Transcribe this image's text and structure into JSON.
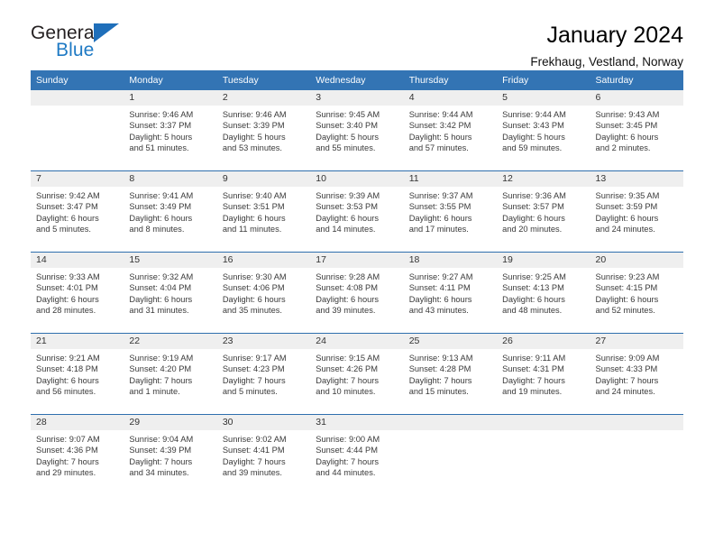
{
  "brand": {
    "name_part1": "General",
    "name_part2": "Blue",
    "accent_color": "#1f7ac4",
    "triangle_color": "#1f6fba"
  },
  "header": {
    "title": "January 2024",
    "subtitle": "Frekhaug, Vestland, Norway"
  },
  "theme": {
    "header_row_bg": "#3374b4",
    "daynum_bg": "#efefef",
    "week_divider": "#2f6fae"
  },
  "calendar": {
    "weekday_headers": [
      "Sunday",
      "Monday",
      "Tuesday",
      "Wednesday",
      "Thursday",
      "Friday",
      "Saturday"
    ],
    "weeks": [
      [
        {
          "day": "",
          "lines": []
        },
        {
          "day": "1",
          "lines": [
            "Sunrise: 9:46 AM",
            "Sunset: 3:37 PM",
            "Daylight: 5 hours",
            "and 51 minutes."
          ]
        },
        {
          "day": "2",
          "lines": [
            "Sunrise: 9:46 AM",
            "Sunset: 3:39 PM",
            "Daylight: 5 hours",
            "and 53 minutes."
          ]
        },
        {
          "day": "3",
          "lines": [
            "Sunrise: 9:45 AM",
            "Sunset: 3:40 PM",
            "Daylight: 5 hours",
            "and 55 minutes."
          ]
        },
        {
          "day": "4",
          "lines": [
            "Sunrise: 9:44 AM",
            "Sunset: 3:42 PM",
            "Daylight: 5 hours",
            "and 57 minutes."
          ]
        },
        {
          "day": "5",
          "lines": [
            "Sunrise: 9:44 AM",
            "Sunset: 3:43 PM",
            "Daylight: 5 hours",
            "and 59 minutes."
          ]
        },
        {
          "day": "6",
          "lines": [
            "Sunrise: 9:43 AM",
            "Sunset: 3:45 PM",
            "Daylight: 6 hours",
            "and 2 minutes."
          ]
        }
      ],
      [
        {
          "day": "7",
          "lines": [
            "Sunrise: 9:42 AM",
            "Sunset: 3:47 PM",
            "Daylight: 6 hours",
            "and 5 minutes."
          ]
        },
        {
          "day": "8",
          "lines": [
            "Sunrise: 9:41 AM",
            "Sunset: 3:49 PM",
            "Daylight: 6 hours",
            "and 8 minutes."
          ]
        },
        {
          "day": "9",
          "lines": [
            "Sunrise: 9:40 AM",
            "Sunset: 3:51 PM",
            "Daylight: 6 hours",
            "and 11 minutes."
          ]
        },
        {
          "day": "10",
          "lines": [
            "Sunrise: 9:39 AM",
            "Sunset: 3:53 PM",
            "Daylight: 6 hours",
            "and 14 minutes."
          ]
        },
        {
          "day": "11",
          "lines": [
            "Sunrise: 9:37 AM",
            "Sunset: 3:55 PM",
            "Daylight: 6 hours",
            "and 17 minutes."
          ]
        },
        {
          "day": "12",
          "lines": [
            "Sunrise: 9:36 AM",
            "Sunset: 3:57 PM",
            "Daylight: 6 hours",
            "and 20 minutes."
          ]
        },
        {
          "day": "13",
          "lines": [
            "Sunrise: 9:35 AM",
            "Sunset: 3:59 PM",
            "Daylight: 6 hours",
            "and 24 minutes."
          ]
        }
      ],
      [
        {
          "day": "14",
          "lines": [
            "Sunrise: 9:33 AM",
            "Sunset: 4:01 PM",
            "Daylight: 6 hours",
            "and 28 minutes."
          ]
        },
        {
          "day": "15",
          "lines": [
            "Sunrise: 9:32 AM",
            "Sunset: 4:04 PM",
            "Daylight: 6 hours",
            "and 31 minutes."
          ]
        },
        {
          "day": "16",
          "lines": [
            "Sunrise: 9:30 AM",
            "Sunset: 4:06 PM",
            "Daylight: 6 hours",
            "and 35 minutes."
          ]
        },
        {
          "day": "17",
          "lines": [
            "Sunrise: 9:28 AM",
            "Sunset: 4:08 PM",
            "Daylight: 6 hours",
            "and 39 minutes."
          ]
        },
        {
          "day": "18",
          "lines": [
            "Sunrise: 9:27 AM",
            "Sunset: 4:11 PM",
            "Daylight: 6 hours",
            "and 43 minutes."
          ]
        },
        {
          "day": "19",
          "lines": [
            "Sunrise: 9:25 AM",
            "Sunset: 4:13 PM",
            "Daylight: 6 hours",
            "and 48 minutes."
          ]
        },
        {
          "day": "20",
          "lines": [
            "Sunrise: 9:23 AM",
            "Sunset: 4:15 PM",
            "Daylight: 6 hours",
            "and 52 minutes."
          ]
        }
      ],
      [
        {
          "day": "21",
          "lines": [
            "Sunrise: 9:21 AM",
            "Sunset: 4:18 PM",
            "Daylight: 6 hours",
            "and 56 minutes."
          ]
        },
        {
          "day": "22",
          "lines": [
            "Sunrise: 9:19 AM",
            "Sunset: 4:20 PM",
            "Daylight: 7 hours",
            "and 1 minute."
          ]
        },
        {
          "day": "23",
          "lines": [
            "Sunrise: 9:17 AM",
            "Sunset: 4:23 PM",
            "Daylight: 7 hours",
            "and 5 minutes."
          ]
        },
        {
          "day": "24",
          "lines": [
            "Sunrise: 9:15 AM",
            "Sunset: 4:26 PM",
            "Daylight: 7 hours",
            "and 10 minutes."
          ]
        },
        {
          "day": "25",
          "lines": [
            "Sunrise: 9:13 AM",
            "Sunset: 4:28 PM",
            "Daylight: 7 hours",
            "and 15 minutes."
          ]
        },
        {
          "day": "26",
          "lines": [
            "Sunrise: 9:11 AM",
            "Sunset: 4:31 PM",
            "Daylight: 7 hours",
            "and 19 minutes."
          ]
        },
        {
          "day": "27",
          "lines": [
            "Sunrise: 9:09 AM",
            "Sunset: 4:33 PM",
            "Daylight: 7 hours",
            "and 24 minutes."
          ]
        }
      ],
      [
        {
          "day": "28",
          "lines": [
            "Sunrise: 9:07 AM",
            "Sunset: 4:36 PM",
            "Daylight: 7 hours",
            "and 29 minutes."
          ]
        },
        {
          "day": "29",
          "lines": [
            "Sunrise: 9:04 AM",
            "Sunset: 4:39 PM",
            "Daylight: 7 hours",
            "and 34 minutes."
          ]
        },
        {
          "day": "30",
          "lines": [
            "Sunrise: 9:02 AM",
            "Sunset: 4:41 PM",
            "Daylight: 7 hours",
            "and 39 minutes."
          ]
        },
        {
          "day": "31",
          "lines": [
            "Sunrise: 9:00 AM",
            "Sunset: 4:44 PM",
            "Daylight: 7 hours",
            "and 44 minutes."
          ]
        },
        {
          "day": "",
          "lines": []
        },
        {
          "day": "",
          "lines": []
        },
        {
          "day": "",
          "lines": []
        }
      ]
    ]
  }
}
